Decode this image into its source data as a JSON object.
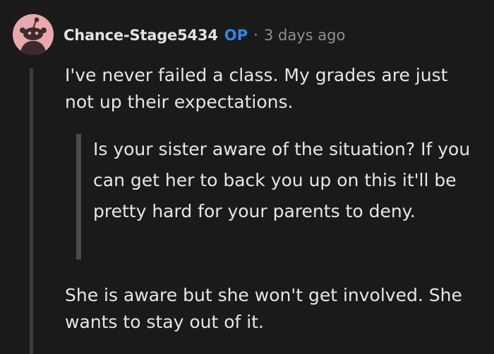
{
  "comment": {
    "avatar_icon": "reddit-snoo-avatar-icon",
    "avatar_color": "#e8a8ad",
    "username": "Chance-Stage5434",
    "op_badge": "OP",
    "separator": "·",
    "timestamp": "3 days ago",
    "body_paragraph_1": "I've never failed a class. My grades are just not up their expectations.",
    "quote": "Is your sister aware of the situation? If you can get her to back you up on this it'll be pretty hard for your parents to deny.",
    "body_paragraph_2": "She is aware but she won't get involved. She wants to stay out of it."
  },
  "colors": {
    "background": "#1a1a1b",
    "op_badge": "#2e88e6",
    "text": "#e6e6e6",
    "muted": "#8f8f8f"
  }
}
